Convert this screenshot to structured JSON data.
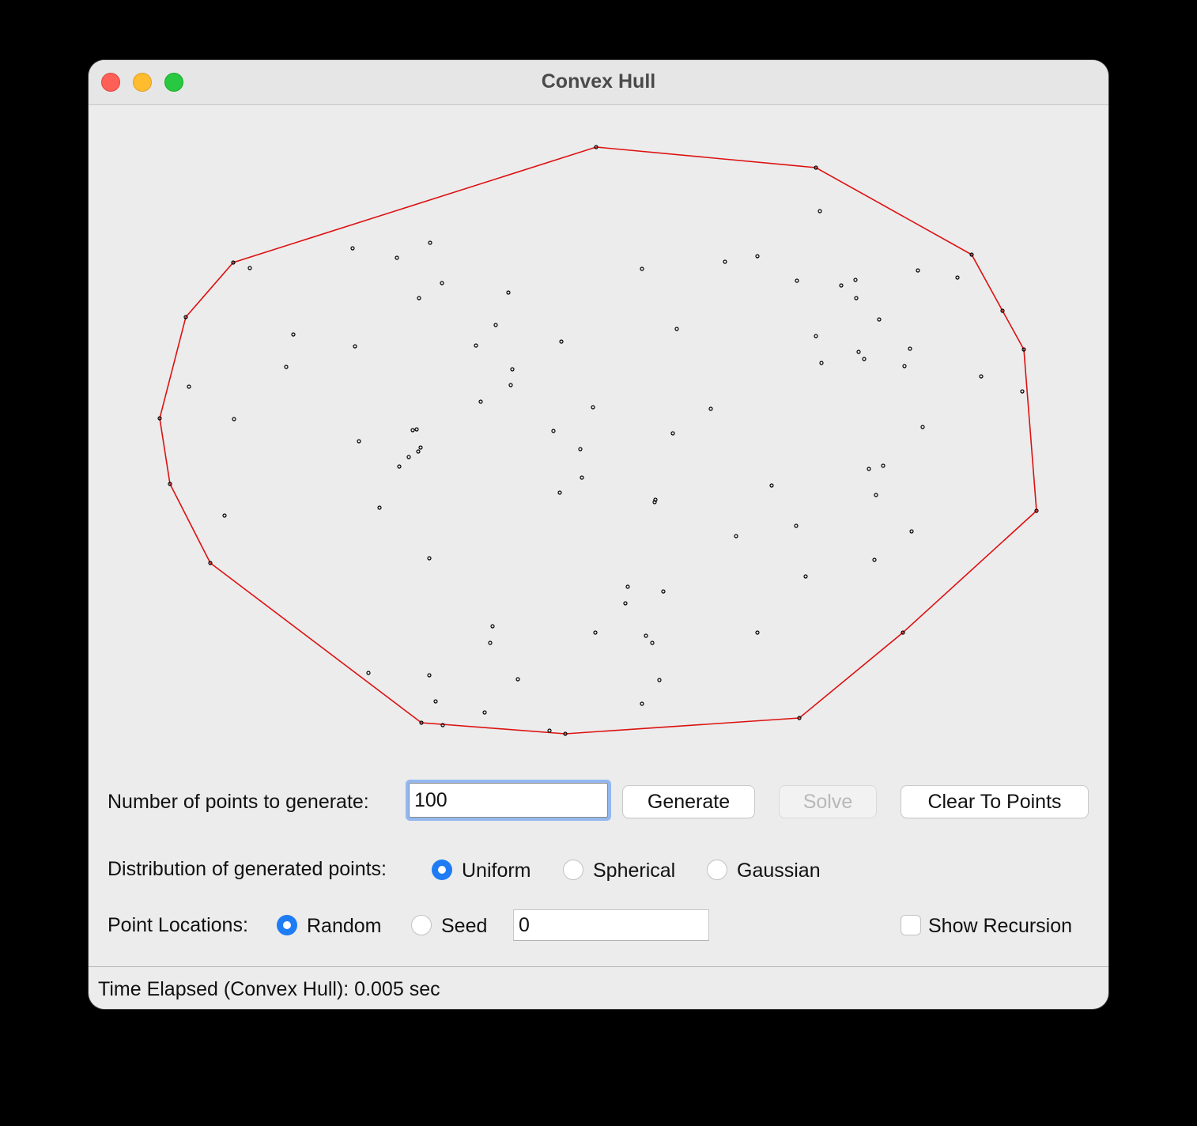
{
  "window": {
    "title": "Convex Hull"
  },
  "controls": {
    "num_points_label": "Number of points to generate:",
    "num_points_value": "100",
    "generate_label": "Generate",
    "solve_label": "Solve",
    "clear_label": "Clear To Points",
    "distribution_label": "Distribution of generated points:",
    "distribution_options": [
      "Uniform",
      "Spherical",
      "Gaussian"
    ],
    "distribution_selected": "Uniform",
    "locations_label": "Point Locations:",
    "location_options": [
      "Random",
      "Seed"
    ],
    "location_selected": "Random",
    "seed_value": "0",
    "show_recursion_label": "Show Recursion",
    "show_recursion_checked": false
  },
  "status": {
    "text": "Time Elapsed (Convex Hull): 0.005 sec"
  },
  "colors": {
    "hull": "#dd1111",
    "point": "#000000",
    "accent": "#1e7cf5"
  },
  "chart_data": {
    "type": "scatter",
    "title": "",
    "xlabel": "",
    "ylabel": "",
    "grid": false,
    "hull": [
      [
        754,
        186
      ],
      [
        1032,
        212
      ],
      [
        1229,
        322
      ],
      [
        1268,
        393
      ],
      [
        1295,
        442
      ],
      [
        1311,
        646
      ],
      [
        1142,
        800
      ],
      [
        1011,
        908
      ],
      [
        715,
        928
      ],
      [
        533,
        914
      ],
      [
        266,
        712
      ],
      [
        215,
        612
      ],
      [
        202,
        529
      ],
      [
        235,
        401
      ],
      [
        295,
        332
      ]
    ],
    "points": [
      [
        754,
        186
      ],
      [
        1032,
        212
      ],
      [
        1229,
        322
      ],
      [
        1268,
        393
      ],
      [
        1295,
        442
      ],
      [
        1311,
        646
      ],
      [
        1142,
        800
      ],
      [
        1011,
        908
      ],
      [
        715,
        928
      ],
      [
        533,
        914
      ],
      [
        266,
        712
      ],
      [
        215,
        612
      ],
      [
        202,
        529
      ],
      [
        235,
        401
      ],
      [
        295,
        332
      ],
      [
        1037,
        267
      ],
      [
        316,
        339
      ],
      [
        446,
        314
      ],
      [
        502,
        326
      ],
      [
        544,
        307
      ],
      [
        559,
        358
      ],
      [
        530,
        377
      ],
      [
        643,
        370
      ],
      [
        812,
        340
      ],
      [
        917,
        331
      ],
      [
        958,
        324
      ],
      [
        1008,
        355
      ],
      [
        1064,
        361
      ],
      [
        1082,
        354
      ],
      [
        1083,
        377
      ],
      [
        1161,
        342
      ],
      [
        1211,
        351
      ],
      [
        1112,
        404
      ],
      [
        627,
        411
      ],
      [
        710,
        432
      ],
      [
        856,
        416
      ],
      [
        1032,
        425
      ],
      [
        1039,
        459
      ],
      [
        1086,
        445
      ],
      [
        1093,
        454
      ],
      [
        1151,
        441
      ],
      [
        1144,
        463
      ],
      [
        1241,
        476
      ],
      [
        1293,
        495
      ],
      [
        371,
        423
      ],
      [
        449,
        438
      ],
      [
        362,
        464
      ],
      [
        602,
        437
      ],
      [
        648,
        467
      ],
      [
        646,
        487
      ],
      [
        239,
        489
      ],
      [
        296,
        530
      ],
      [
        608,
        508
      ],
      [
        750,
        515
      ],
      [
        899,
        517
      ],
      [
        1167,
        540
      ],
      [
        700,
        545
      ],
      [
        851,
        548
      ],
      [
        522,
        544
      ],
      [
        527,
        543
      ],
      [
        454,
        558
      ],
      [
        532,
        566
      ],
      [
        529,
        571
      ],
      [
        517,
        578
      ],
      [
        505,
        590
      ],
      [
        734,
        568
      ],
      [
        736,
        604
      ],
      [
        1099,
        593
      ],
      [
        1117,
        589
      ],
      [
        976,
        614
      ],
      [
        1108,
        626
      ],
      [
        708,
        623
      ],
      [
        829,
        632
      ],
      [
        828,
        635
      ],
      [
        480,
        642
      ],
      [
        284,
        652
      ],
      [
        1007,
        665
      ],
      [
        1153,
        672
      ],
      [
        931,
        678
      ],
      [
        543,
        706
      ],
      [
        1106,
        708
      ],
      [
        1019,
        729
      ],
      [
        794,
        742
      ],
      [
        839,
        748
      ],
      [
        791,
        763
      ],
      [
        623,
        792
      ],
      [
        753,
        800
      ],
      [
        958,
        800
      ],
      [
        817,
        804
      ],
      [
        825,
        813
      ],
      [
        620,
        813
      ],
      [
        466,
        851
      ],
      [
        543,
        854
      ],
      [
        655,
        859
      ],
      [
        834,
        860
      ],
      [
        551,
        887
      ],
      [
        812,
        890
      ],
      [
        613,
        901
      ],
      [
        560,
        917
      ],
      [
        695,
        924
      ]
    ]
  }
}
